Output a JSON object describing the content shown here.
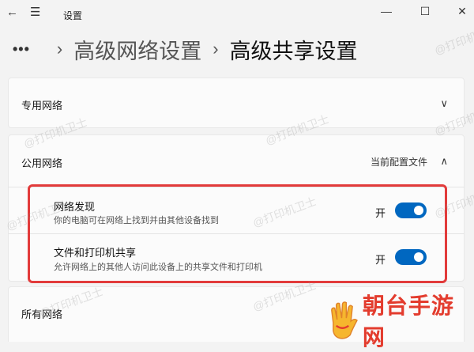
{
  "titlebar": {
    "title": "设置",
    "back_icon": "←",
    "menu_icon": "☰",
    "min_icon": "—",
    "max_icon": "☐",
    "close_icon": "✕"
  },
  "breadcrumb": {
    "more": "•••",
    "separator": "›",
    "parent": "高级网络设置",
    "current": "高级共享设置"
  },
  "sections": {
    "private": {
      "title": "专用网络",
      "chevron": "∨"
    },
    "public": {
      "title": "公用网络",
      "profile_label": "当前配置文件",
      "chevron": "∧",
      "items": [
        {
          "title": "网络发现",
          "description": "你的电脑可在网络上找到并由其他设备找到",
          "state": "开",
          "on": true
        },
        {
          "title": "文件和打印机共享",
          "description": "允许网络上的其他人访问此设备上的共享文件和打印机",
          "state": "开",
          "on": true
        }
      ]
    },
    "all": {
      "title": "所有网络"
    }
  },
  "watermark": "@打印机卫士",
  "brand": {
    "text": "朝台手游网",
    "color": "#e33c2e"
  },
  "colors": {
    "accent": "#0067c0",
    "highlight": "#e23b3b"
  }
}
